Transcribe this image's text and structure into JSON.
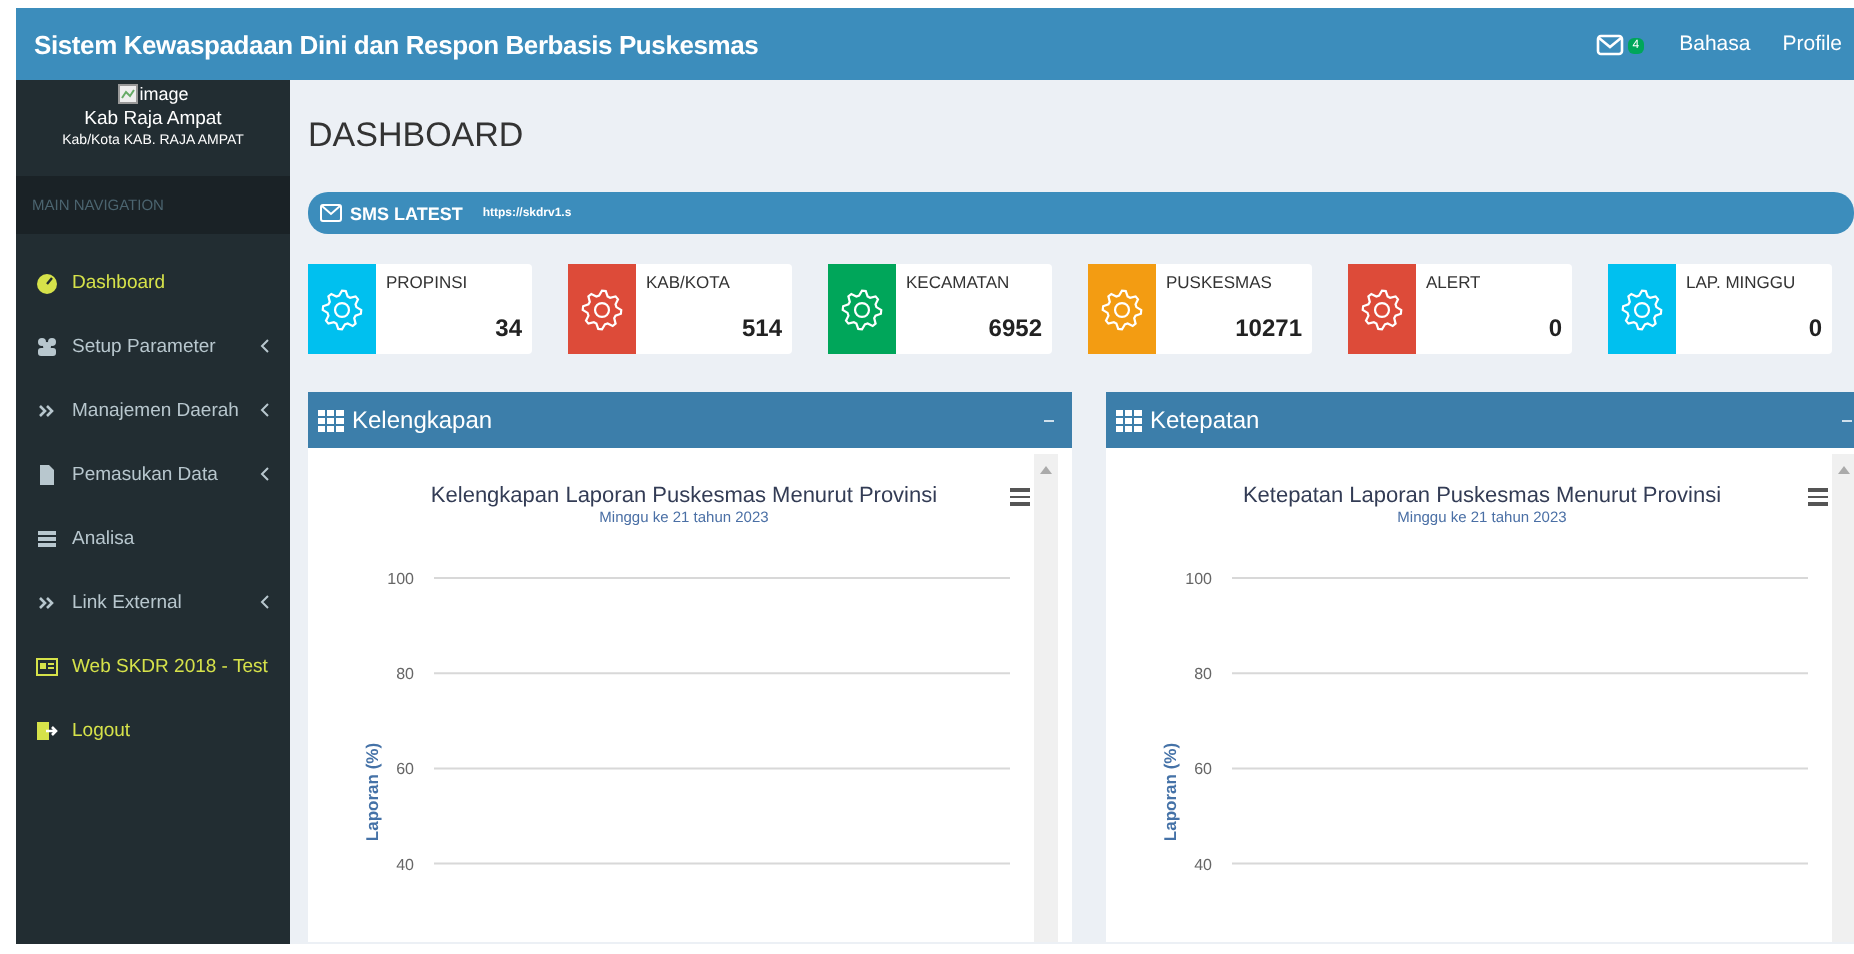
{
  "top_bar": {
    "title": "Sistem Kewaspadaan Dini dan Respon Berbasis Puskesmas",
    "mail_badge": "4",
    "links": [
      "Bahasa",
      "Profile"
    ]
  },
  "sidebar": {
    "logo_alt": "image",
    "user_name": "Kab Raja Ampat",
    "user_region": "Kab/Kota KAB. RAJA AMPAT",
    "section": "MAIN NAVIGATION",
    "items": [
      {
        "label": "Dashboard",
        "highlighted": true,
        "expandable": false
      },
      {
        "label": "Setup Parameter",
        "highlighted": false,
        "expandable": true
      },
      {
        "label": "Manajemen Daerah",
        "highlighted": false,
        "expandable": true
      },
      {
        "label": "Pemasukan Data",
        "highlighted": false,
        "expandable": true
      },
      {
        "label": "Analisa",
        "highlighted": false,
        "expandable": false
      },
      {
        "label": "Link External",
        "highlighted": false,
        "expandable": true
      },
      {
        "label": "Web SKDR 2018 - Test",
        "highlighted": true,
        "expandable": false
      },
      {
        "label": "Logout",
        "highlighted": true,
        "expandable": false
      }
    ]
  },
  "page_title": "DASHBOARD",
  "sms_bar": {
    "label": "SMS LATEST",
    "link": "https://skdrv1.s"
  },
  "info_boxes": [
    {
      "label": "PROPINSI",
      "value": "34",
      "color": "#00c0ef"
    },
    {
      "label": "KAB/KOTA",
      "value": "514",
      "color": "#dd4b39"
    },
    {
      "label": "KECAMATAN",
      "value": "6952",
      "color": "#00a65a"
    },
    {
      "label": "PUSKESMAS",
      "value": "10271",
      "color": "#f39c12"
    },
    {
      "label": "ALERT",
      "value": "0",
      "color": "#dd4b39"
    },
    {
      "label": "LAP. MINGGU",
      "value": "0",
      "color": "#00c0ef"
    }
  ],
  "panels": [
    {
      "title": "Kelengkapan",
      "chart": {
        "title": "Kelengkapan Laporan Puskesmas Menurut Provinsi",
        "subtitle": "Minggu ke 21 tahun 2023",
        "y_axis_title": "Laporan (%)",
        "y_ticks": [
          "100",
          "80",
          "60",
          "40"
        ]
      }
    },
    {
      "title": "Ketepatan",
      "chart": {
        "title": "Ketepatan Laporan Puskesmas Menurut Provinsi",
        "subtitle": "Minggu ke 21 tahun 2023",
        "y_axis_title": "Laporan (%)",
        "y_ticks": [
          "100",
          "80",
          "60",
          "40"
        ]
      }
    }
  ]
}
